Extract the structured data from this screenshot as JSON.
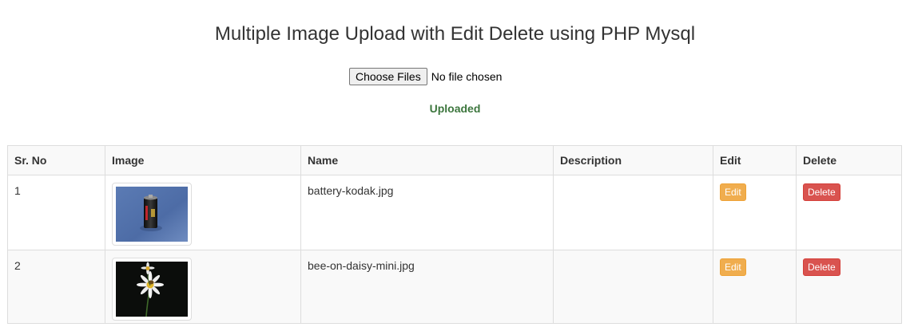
{
  "page": {
    "title": "Multiple Image Upload with Edit Delete using PHP Mysql"
  },
  "upload": {
    "button_label": "Choose Files",
    "status_text": "No file chosen",
    "message": "Uploaded"
  },
  "table": {
    "headers": [
      "Sr. No",
      "Image",
      "Name",
      "Description",
      "Edit",
      "Delete"
    ],
    "rows": [
      {
        "sr": "1",
        "image_icon": "battery-photo",
        "name": "battery-kodak.jpg",
        "description": "",
        "edit_label": "Edit",
        "delete_label": "Delete"
      },
      {
        "sr": "2",
        "image_icon": "bee-on-daisy-photo",
        "name": "bee-on-daisy-mini.jpg",
        "description": "",
        "edit_label": "Edit",
        "delete_label": "Delete"
      }
    ]
  },
  "colors": {
    "success": "#3c763d",
    "edit_button": "#f0ad4e",
    "delete_button": "#d9534f",
    "border": "#dddddd",
    "stripe": "#f9f9f9"
  }
}
